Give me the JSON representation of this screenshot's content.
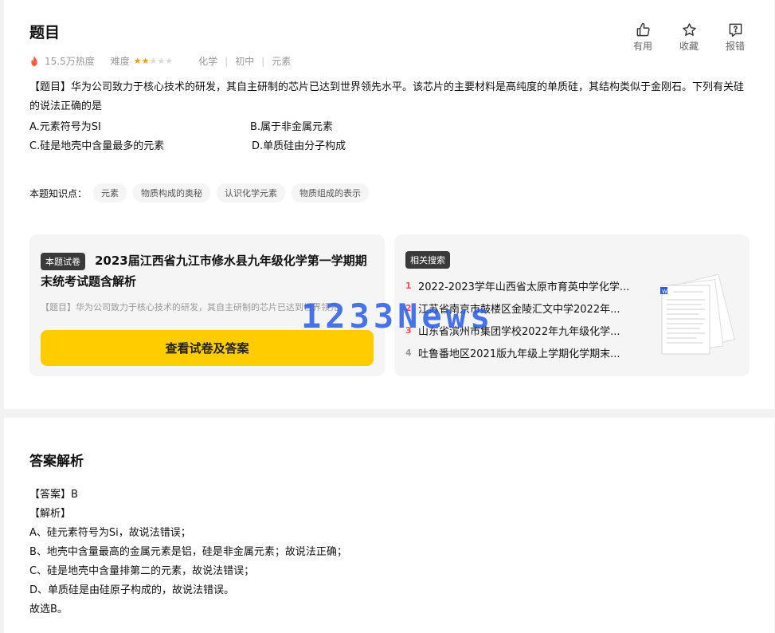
{
  "question": {
    "heading": "题目",
    "actions": [
      {
        "label": "有用",
        "icon": "thumbs-up-icon"
      },
      {
        "label": "收藏",
        "icon": "star-icon"
      },
      {
        "label": "报错",
        "icon": "report-icon"
      }
    ],
    "heat": "15.5万热度",
    "difficulty_label": "难度",
    "difficulty_stars": 2,
    "difficulty_max": 5,
    "tags": [
      "化学",
      "初中",
      "元素"
    ],
    "text": "【题目】华为公司致力于核心技术的研发，其自主研制的芯片已达到世界领先水平。该芯片的主要材料是高纯度的单质硅，其结构类似于金刚石。下列有关硅的说法正确的是",
    "options": {
      "a": "A.元素符号为SI",
      "b": "B.属于非金属元素",
      "c": "C.硅是地壳中含量最多的元素",
      "d": "D.单质硅由分子构成"
    },
    "knowledge_label": "本题知识点：",
    "knowledge_tags": [
      "元素",
      "物质构成的奥秘",
      "认识化学元素",
      "物质组成的表示"
    ]
  },
  "paper": {
    "badge": "本题试卷",
    "title": "2023届江西省九江市修水县九年级化学第一学期期末统考试题含解析",
    "snippet": "【题目】华为公司致力于核心技术的研发，其自主研制的芯片已达到世界领先",
    "button": "查看试卷及答案"
  },
  "related": {
    "badge": "相关搜索",
    "items": [
      {
        "num": "1",
        "text": "2022-2023学年山西省太原市育英中学化学..."
      },
      {
        "num": "2",
        "text": "江苏省南京市鼓楼区金陵汇文中学2022年..."
      },
      {
        "num": "3",
        "text": "山东省滨州市集团学校2022年九年级化学..."
      },
      {
        "num": "4",
        "text": "吐鲁番地区2021版九年级上学期化学期末..."
      }
    ]
  },
  "watermark": "1233News",
  "answer": {
    "heading": "答案解析",
    "lines": [
      "【答案】B",
      "【解析】",
      "A、硅元素符号为Si，故说法错误；",
      "B、地壳中含量最高的金属元素是铝，硅是非金属元素；故说法正确；",
      "C、硅是地壳中含量排第二的元素，故说法错误；",
      "D、单质硅是由硅原子构成的，故说法错误。",
      "故选B。"
    ]
  },
  "colors": {
    "accent_yellow": "#ffcc00",
    "star_on": "#f59a23",
    "rank_top": "#ff4d4f",
    "rank_rest": "#999999",
    "fire": "#ff5a3c"
  }
}
